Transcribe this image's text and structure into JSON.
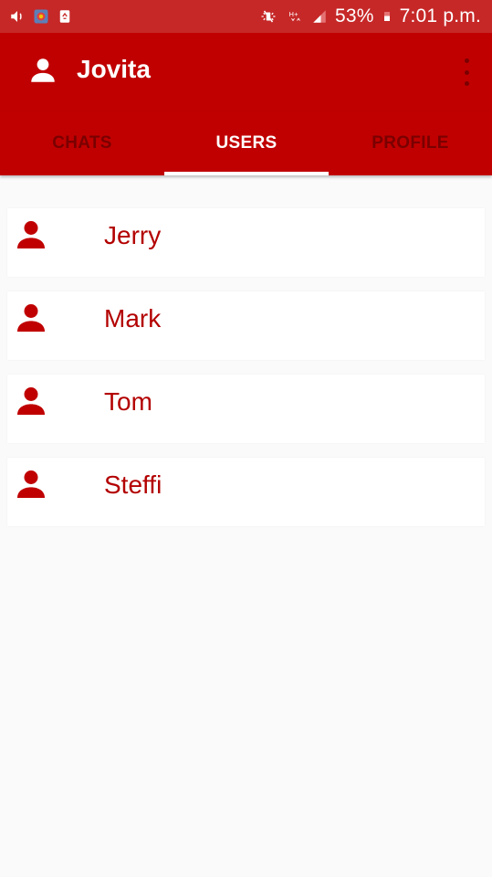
{
  "status_bar": {
    "left_icons": [
      "volume-icon",
      "app-icon",
      "recycle-icon"
    ],
    "right_icons": [
      "mute-icon",
      "network-hplus-icon",
      "signal-icon"
    ],
    "battery": "53%",
    "time": "7:01 p.m."
  },
  "app_bar": {
    "title": "Jovita",
    "title_icon": "person-icon",
    "menu_icon": "more-vert-icon"
  },
  "tabs": [
    {
      "label": "CHATS",
      "active": false
    },
    {
      "label": "USERS",
      "active": true
    },
    {
      "label": "PROFILE",
      "active": false
    }
  ],
  "users": [
    {
      "name": "Jerry",
      "icon": "person-icon"
    },
    {
      "name": "Mark",
      "icon": "person-icon"
    },
    {
      "name": "Tom",
      "icon": "person-icon"
    },
    {
      "name": "Steffi",
      "icon": "person-icon"
    }
  ],
  "colors": {
    "status_bar": "#c62828",
    "primary": "#c00000",
    "inactive_tab_text": "#7a0000",
    "accent_text": "#b30000",
    "background": "#fafafa"
  }
}
